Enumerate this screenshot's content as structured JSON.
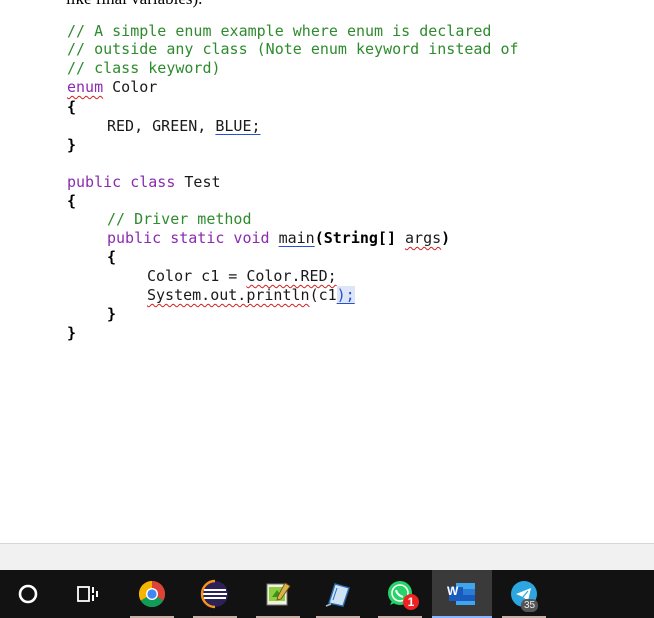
{
  "document": {
    "cutoff_text": "like final variables).",
    "lines": {
      "l1": "// A simple enum example where enum is declared",
      "l2": "// outside any class (Note enum keyword instead of",
      "l3": "// class keyword)",
      "l4_kw": "enum",
      "l4_name": " Color",
      "l5": "{",
      "l6_text": "RED, GREEN, ",
      "l6_ul": "BLUE;",
      "l7": "}",
      "l8_kw": "public class",
      "l8_name": " Test",
      "l9": "{",
      "l10": "// Driver method",
      "l11_kw": "public static void",
      "l11_main": "main",
      "l11_rest": "(String[] ",
      "l11_args": "args",
      "l11_end": ")",
      "l12": "{",
      "l13_text": "Color c1 = ",
      "l13_sq": "Color.RED;",
      "l14_sq": "System.out.println",
      "l14_rest": "(c1",
      "l14_end": ");",
      "l15": "}",
      "l16": "}"
    }
  },
  "taskbar": {
    "items": [
      {
        "name": "Start"
      },
      {
        "name": "Task View"
      },
      {
        "name": "Google Chrome"
      },
      {
        "name": "Eclipse"
      },
      {
        "name": "Notepad++"
      },
      {
        "name": "Notes"
      },
      {
        "name": "WhatsApp",
        "badge": "1"
      },
      {
        "name": "Microsoft Word",
        "letter": "W"
      },
      {
        "name": "Telegram",
        "badge": "35"
      }
    ]
  }
}
